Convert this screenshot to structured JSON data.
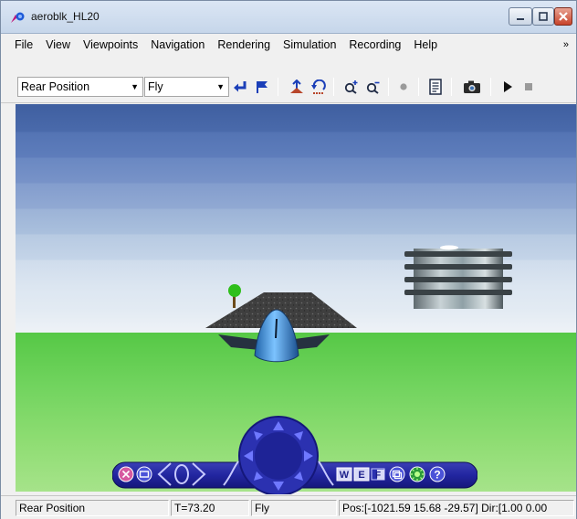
{
  "window": {
    "title": "aeroblk_HL20"
  },
  "menu": {
    "items": [
      "File",
      "View",
      "Viewpoints",
      "Navigation",
      "Rendering",
      "Simulation",
      "Recording",
      "Help"
    ],
    "more": "»"
  },
  "toolbar": {
    "viewpoint_value": "Rear Position",
    "navigation_mode_value": "Fly"
  },
  "nav_panel": {
    "buttons": [
      "W",
      "E",
      "F"
    ]
  },
  "status": {
    "viewpoint": "Rear Position",
    "time": "T=73.20",
    "mode": "Fly",
    "position": "Pos:[-1021.59 15.68 -29.57] Dir:[1.00 0.00"
  }
}
